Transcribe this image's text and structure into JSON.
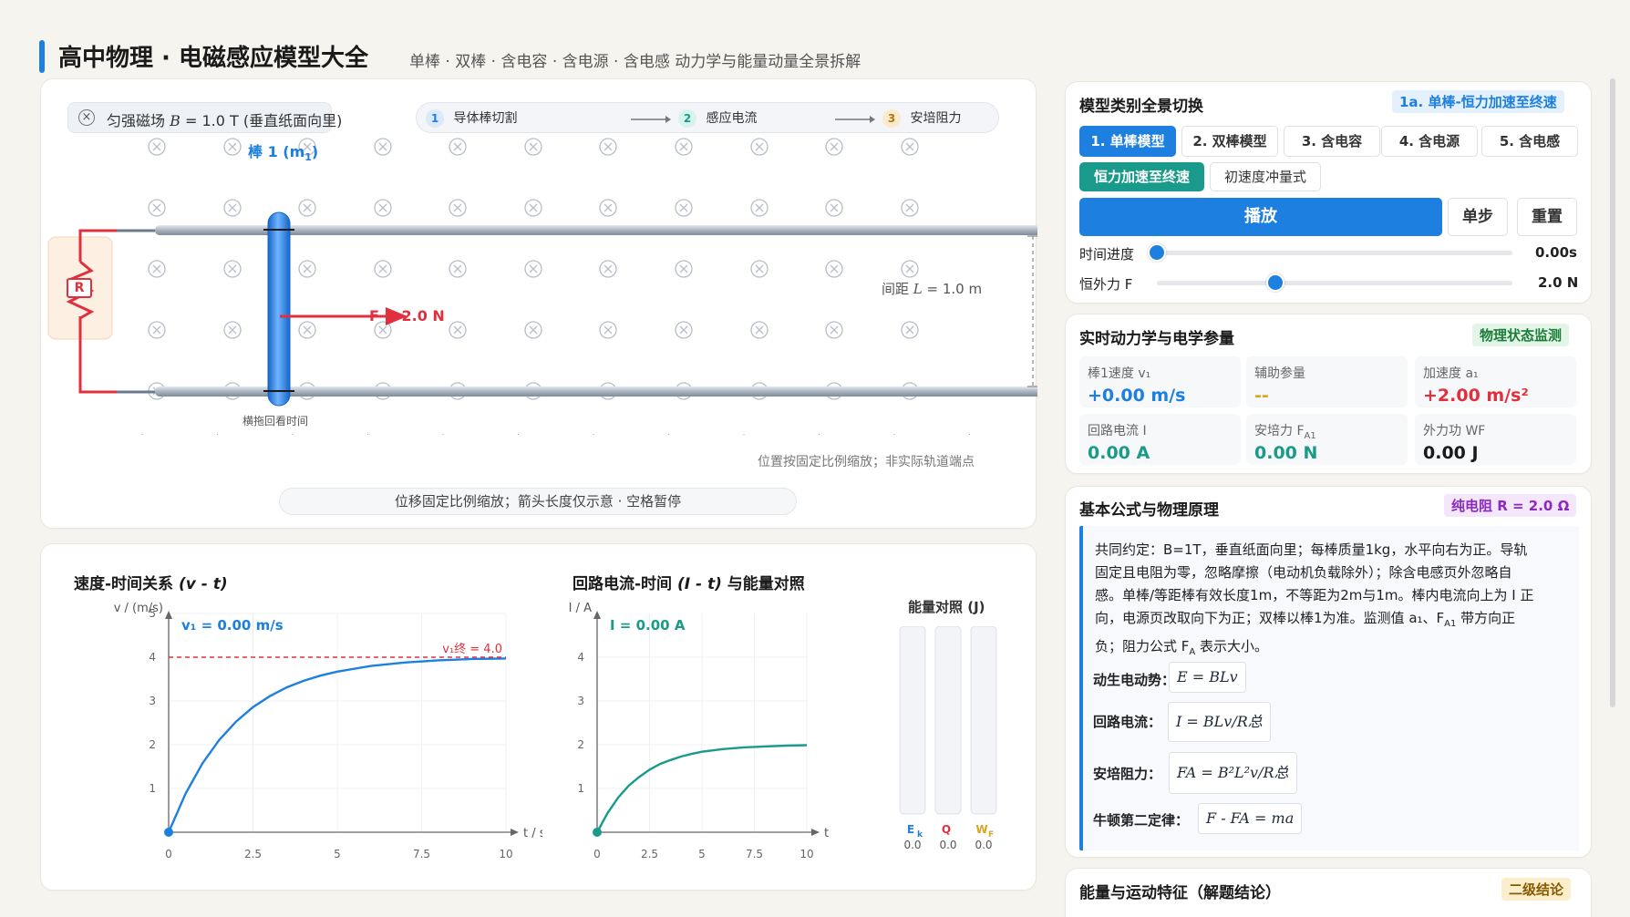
{
  "header": {
    "title": "高中物理 · 电磁感应模型大全",
    "subtitle": "单棒 · 双棒 · 含电容 · 含电源 · 含电感 动力学与能量动量全景拆解"
  },
  "sim": {
    "field_label": "匀强磁场",
    "field_var": "B",
    "field_value": "= 1.0 T (垂直纸面向里)",
    "flow": [
      {
        "num": "1",
        "label": "导体棒切割"
      },
      {
        "num": "2",
        "label": "感应电流"
      },
      {
        "num": "3",
        "label": "安培阻力"
      }
    ],
    "rod_label_main": "棒 1 (m",
    "rod_label_sub": "1",
    "rod_label_end": ")",
    "force_label": "F = 2.0 N",
    "resistor_label": "R",
    "spacing_prefix": "间距 ",
    "spacing_var": "L",
    "spacing_value": " = 1.0 m",
    "drag_hint": "横拖回看时间",
    "scale_note": "位置按固定比例缩放；非实际轨道端点",
    "bottom_hint": "位移固定比例缩放；箭头长度仅示意 · 空格暂停"
  },
  "models": {
    "heading": "模型类别全景切换",
    "current_badge": "1a. 单棒-恒力加速至终速",
    "tabs": [
      {
        "label": "1. 单棒模型",
        "active": true
      },
      {
        "label": "2. 双棒模型",
        "active": false
      },
      {
        "label": "3. 含电容",
        "active": false
      },
      {
        "label": "4. 含电源",
        "active": false
      },
      {
        "label": "5. 含电感",
        "active": false
      }
    ],
    "subtabs": [
      {
        "label": "恒力加速至终速",
        "active": true
      },
      {
        "label": "初速度冲量式",
        "active": false
      }
    ],
    "play_label": "播放",
    "step_label": "单步",
    "reset_label": "重置",
    "time_label": "时间进度",
    "time_value": "0.00s",
    "time_fraction": 0.0,
    "force_label": "恒外力 F",
    "force_value": "2.0 N",
    "force_fraction": 0.333
  },
  "params": {
    "heading": "实时动力学与电学参量",
    "badge": "物理状态监测",
    "items": [
      {
        "label": "棒1速度 v₁",
        "value": "+0.00 m/s",
        "color": "#1d7fe0"
      },
      {
        "label": "辅助参量",
        "value": "--",
        "color": "#e0a31d"
      },
      {
        "label": "加速度 a₁",
        "value": "+2.00 m/s²",
        "color": "#e0303d"
      },
      {
        "label": "回路电流 I",
        "value": "0.00 A",
        "color": "#1a9a8a"
      },
      {
        "label": "安培力 F",
        "label_sub": "A1",
        "value": "0.00 N",
        "color": "#1a9a8a"
      },
      {
        "label": "外力功 WF",
        "value": "0.00 J",
        "color": "#1a1a1a"
      }
    ]
  },
  "formulas": {
    "heading": "基本公式与物理原理",
    "badge": "纯电阻 R = 2.0 Ω",
    "note_lines": [
      "共同约定：B=1T，垂直纸面向里；每棒质量1kg，水平向右为正。导轨",
      "固定且电阻为零，忽略摩擦（电动机负载除外）；除含电感页外忽略自",
      "感。单棒/等距棒有效长度1m，不等距为2m与1m。棒内电流向上为 I 正",
      "向，电源页改取向下为正；双棒以棒1为准。监测值 a₁、F",
      "负；阻力公式 F"
    ],
    "note_sub1": "A1",
    "note_tail1": " 带方向正",
    "note_sub2": "A",
    "note_tail2": " 表示大小。",
    "rows": [
      {
        "label": "动生电动势：",
        "formula": "E = BLv"
      },
      {
        "label": "回路电流：",
        "formula": "I = BLv/R总"
      },
      {
        "label": "安培阻力：",
        "formula": "FA = B²L²v/R总"
      },
      {
        "label": "牛顿第二定律：",
        "formula": "F - FA = ma"
      }
    ]
  },
  "energy_section": {
    "heading": "能量与运动特征（解题结论）",
    "badge": "二级结论"
  },
  "chart_data": [
    {
      "type": "line",
      "title": "速度-时间关系 (v - t)",
      "title_main": "速度-时间关系 ",
      "title_var": "(v - t)",
      "ylabel": "v / (m/s)",
      "xlabel": "t / s",
      "readout": "v₁ = 0.00 m/s",
      "xlim": [
        0,
        10
      ],
      "ylim": [
        0,
        5
      ],
      "xticks": [
        0,
        2.5,
        5,
        7.5,
        10
      ],
      "xtick_labels": [
        "0",
        "2.5",
        "5",
        "7.5",
        "10"
      ],
      "yticks": [
        1,
        2,
        3,
        4,
        5
      ],
      "ytick_labels": [
        "1",
        "2",
        "3",
        "4",
        "5"
      ],
      "terminal_value": 4.0,
      "terminal_label": "v₁终 = 4.0",
      "series": [
        {
          "x": [
            0,
            0.5,
            1,
            1.5,
            2,
            2.5,
            3,
            3.5,
            4,
            4.5,
            5,
            6,
            7,
            8,
            9,
            10
          ],
          "values": [
            0,
            0.88,
            1.57,
            2.11,
            2.53,
            2.86,
            3.11,
            3.31,
            3.46,
            3.58,
            3.67,
            3.8,
            3.88,
            3.93,
            3.96,
            3.97
          ],
          "color": "#1d7fe0"
        }
      ]
    },
    {
      "type": "line",
      "title": "回路电流-时间 (I - t) 与能量对照",
      "title_main": "回路电流-时间 ",
      "title_var": "(I - t)",
      "title_end": " 与能量对照",
      "ylabel": "I / A",
      "xlabel": "t / s",
      "readout": "I = 0.00 A",
      "xlim": [
        0,
        10
      ],
      "ylim": [
        0,
        5
      ],
      "xticks": [
        0,
        2.5,
        5,
        7.5,
        10
      ],
      "xtick_labels": [
        "0",
        "2.5",
        "5",
        "7.5",
        "10"
      ],
      "yticks": [
        1,
        2,
        3,
        4
      ],
      "ytick_labels": [
        "1",
        "2",
        "3",
        "4"
      ],
      "series": [
        {
          "x": [
            0,
            0.5,
            1,
            1.5,
            2,
            2.5,
            3,
            3.5,
            4,
            4.5,
            5,
            6,
            7,
            8,
            9,
            10
          ],
          "values": [
            0,
            0.44,
            0.79,
            1.06,
            1.26,
            1.43,
            1.56,
            1.65,
            1.73,
            1.79,
            1.84,
            1.9,
            1.94,
            1.96,
            1.98,
            1.99
          ],
          "color": "#1a9a8a"
        }
      ]
    },
    {
      "type": "bar",
      "title": "能量对照 (J)",
      "categories": [
        "Ek",
        "Q",
        "WF"
      ],
      "category_main": [
        "E",
        "Q",
        "W"
      ],
      "category_sub": [
        "k",
        "",
        "F"
      ],
      "category_colors": [
        "#1d7fe0",
        "#e0303d",
        "#e0a31d"
      ],
      "values": [
        0.0,
        0.0,
        0.0
      ],
      "value_labels": [
        "0.0",
        "0.0",
        "0.0"
      ]
    }
  ]
}
